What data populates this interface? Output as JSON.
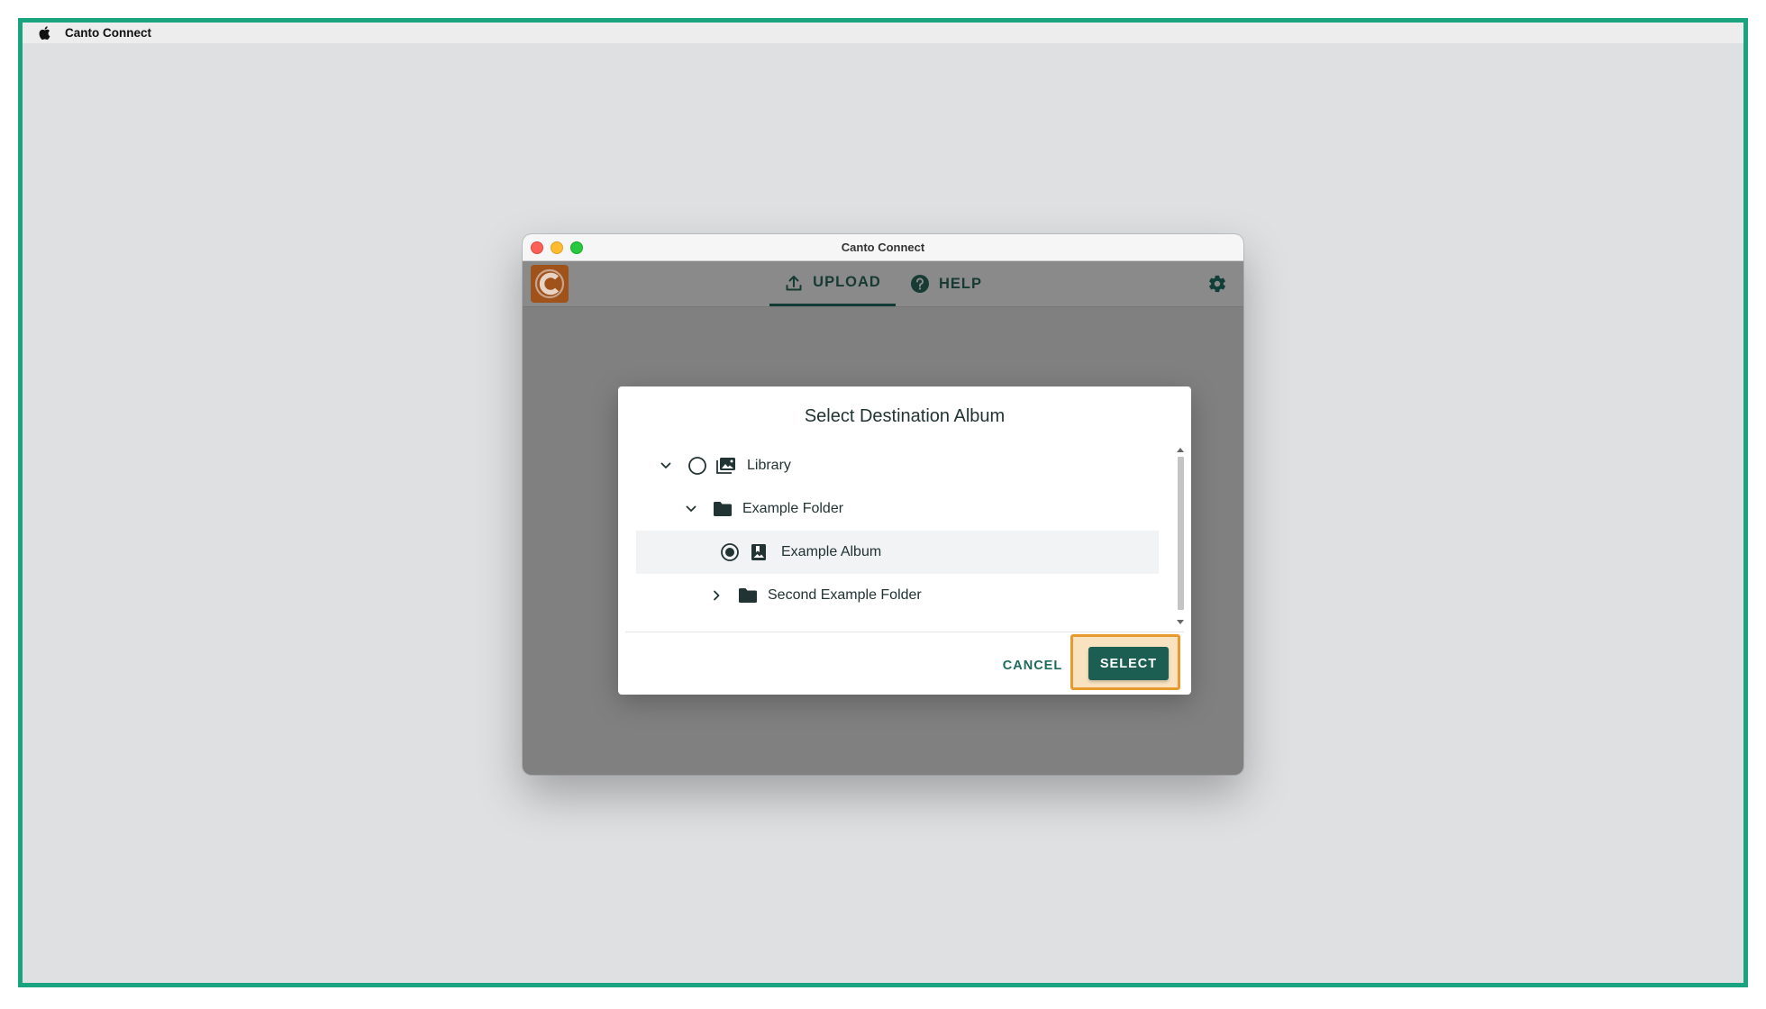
{
  "menubar": {
    "app_name": "Canto Connect"
  },
  "window": {
    "title": "Canto Connect"
  },
  "appbar": {
    "tabs": [
      {
        "label": "UPLOAD",
        "icon": "upload-icon",
        "active": true
      },
      {
        "label": "HELP",
        "icon": "help-icon",
        "active": false
      }
    ],
    "settings_icon": "gear-icon",
    "logo_icon": "canto-logo-icon"
  },
  "dialog": {
    "title": "Select Destination Album",
    "tree": [
      {
        "label": "Library",
        "type": "library",
        "expanded": true,
        "selectable": true,
        "selected": false
      },
      {
        "label": "Example Folder",
        "type": "folder",
        "expanded": true,
        "selectable": false
      },
      {
        "label": "Example Album",
        "type": "album",
        "selectable": true,
        "selected": true
      },
      {
        "label": "Second Example Folder",
        "type": "folder",
        "expanded": false,
        "selectable": false
      }
    ],
    "cancel_label": "CANCEL",
    "select_label": "SELECT"
  },
  "colors": {
    "frame_border": "#19a37f",
    "primary": "#1d5e52",
    "highlight_border": "#e79a2d",
    "logo": "#a0521b"
  }
}
